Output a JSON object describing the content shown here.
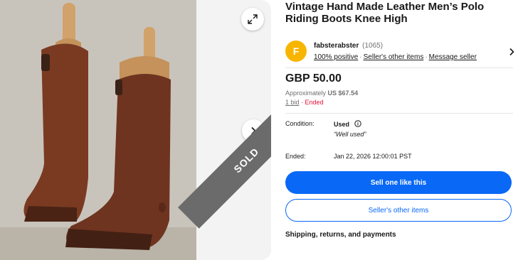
{
  "listing": {
    "title": "Vintage Hand Made Leather Men’s Polo Riding Boots Knee High",
    "sold_label": "SOLD"
  },
  "seller": {
    "avatar_letter": "F",
    "avatar_color": "#f7b500",
    "name": "fabsterabster",
    "feedback_count": "(1065)",
    "positive": "100% positive",
    "other_items_link": "Seller's other items",
    "message_link": "Message seller"
  },
  "price": {
    "amount": "GBP 50.00",
    "approx_prefix": "Approximately",
    "approx_value": "US $67.54",
    "bids": "1 bid",
    "status": "Ended"
  },
  "details": {
    "condition_label": "Condition:",
    "condition_value": "Used",
    "condition_note": "“Well used”",
    "ended_label": "Ended:",
    "ended_value": "Jan 22, 2026 12:00:01 PST"
  },
  "actions": {
    "sell_one": "Sell one like this",
    "seller_items": "Seller's other items"
  },
  "shipping_heading": "Shipping, returns, and payments",
  "icons": {
    "expand": "expand-icon",
    "next": "chevron-right-icon",
    "seller_chevron": "chevron-right-icon",
    "info": "info-icon"
  },
  "colors": {
    "accent": "#0968f6",
    "ended": "#e0103a",
    "sold_ribbon": "#6b6b6b"
  }
}
